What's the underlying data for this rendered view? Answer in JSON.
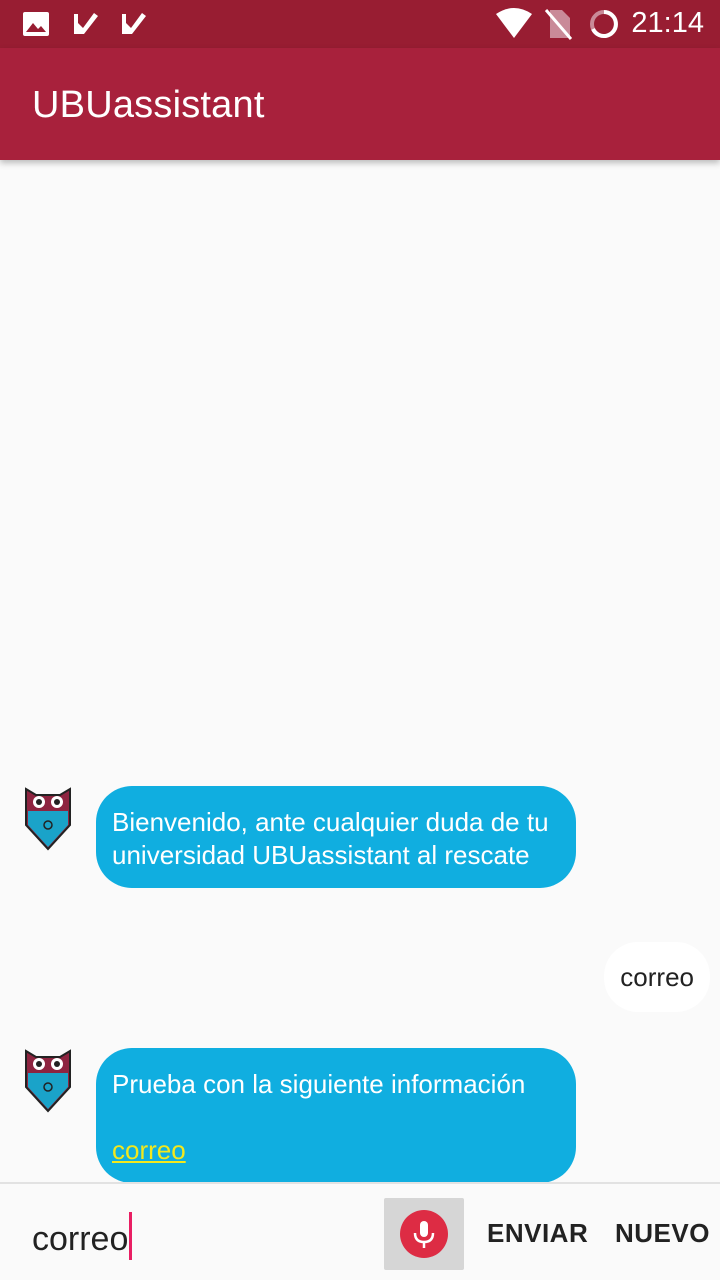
{
  "status_bar": {
    "time": "21:14",
    "left_icons": [
      "image-icon",
      "check-icon",
      "check-icon"
    ],
    "right_icons": [
      "wifi-icon",
      "no-sim-icon",
      "loading-ring-icon"
    ]
  },
  "app_bar": {
    "title": "UBUassistant"
  },
  "messages": [
    {
      "from": "bot",
      "text": "Bienvenido, ante cualquier duda de tu universidad UBUassistant al rescate"
    },
    {
      "from": "user",
      "text": "correo"
    },
    {
      "from": "bot",
      "text": "Prueba con la siguiente información",
      "link": "correo"
    }
  ],
  "input": {
    "value": "correo"
  },
  "buttons": {
    "send": "ENVIAR",
    "new": "NUEVO"
  },
  "colors": {
    "status_bar": "#981d32",
    "app_bar": "#a8213c",
    "bot_bubble": "#10aee0",
    "link": "#f2e81d",
    "mic": "#dd2c44",
    "cursor": "#e91e63"
  }
}
